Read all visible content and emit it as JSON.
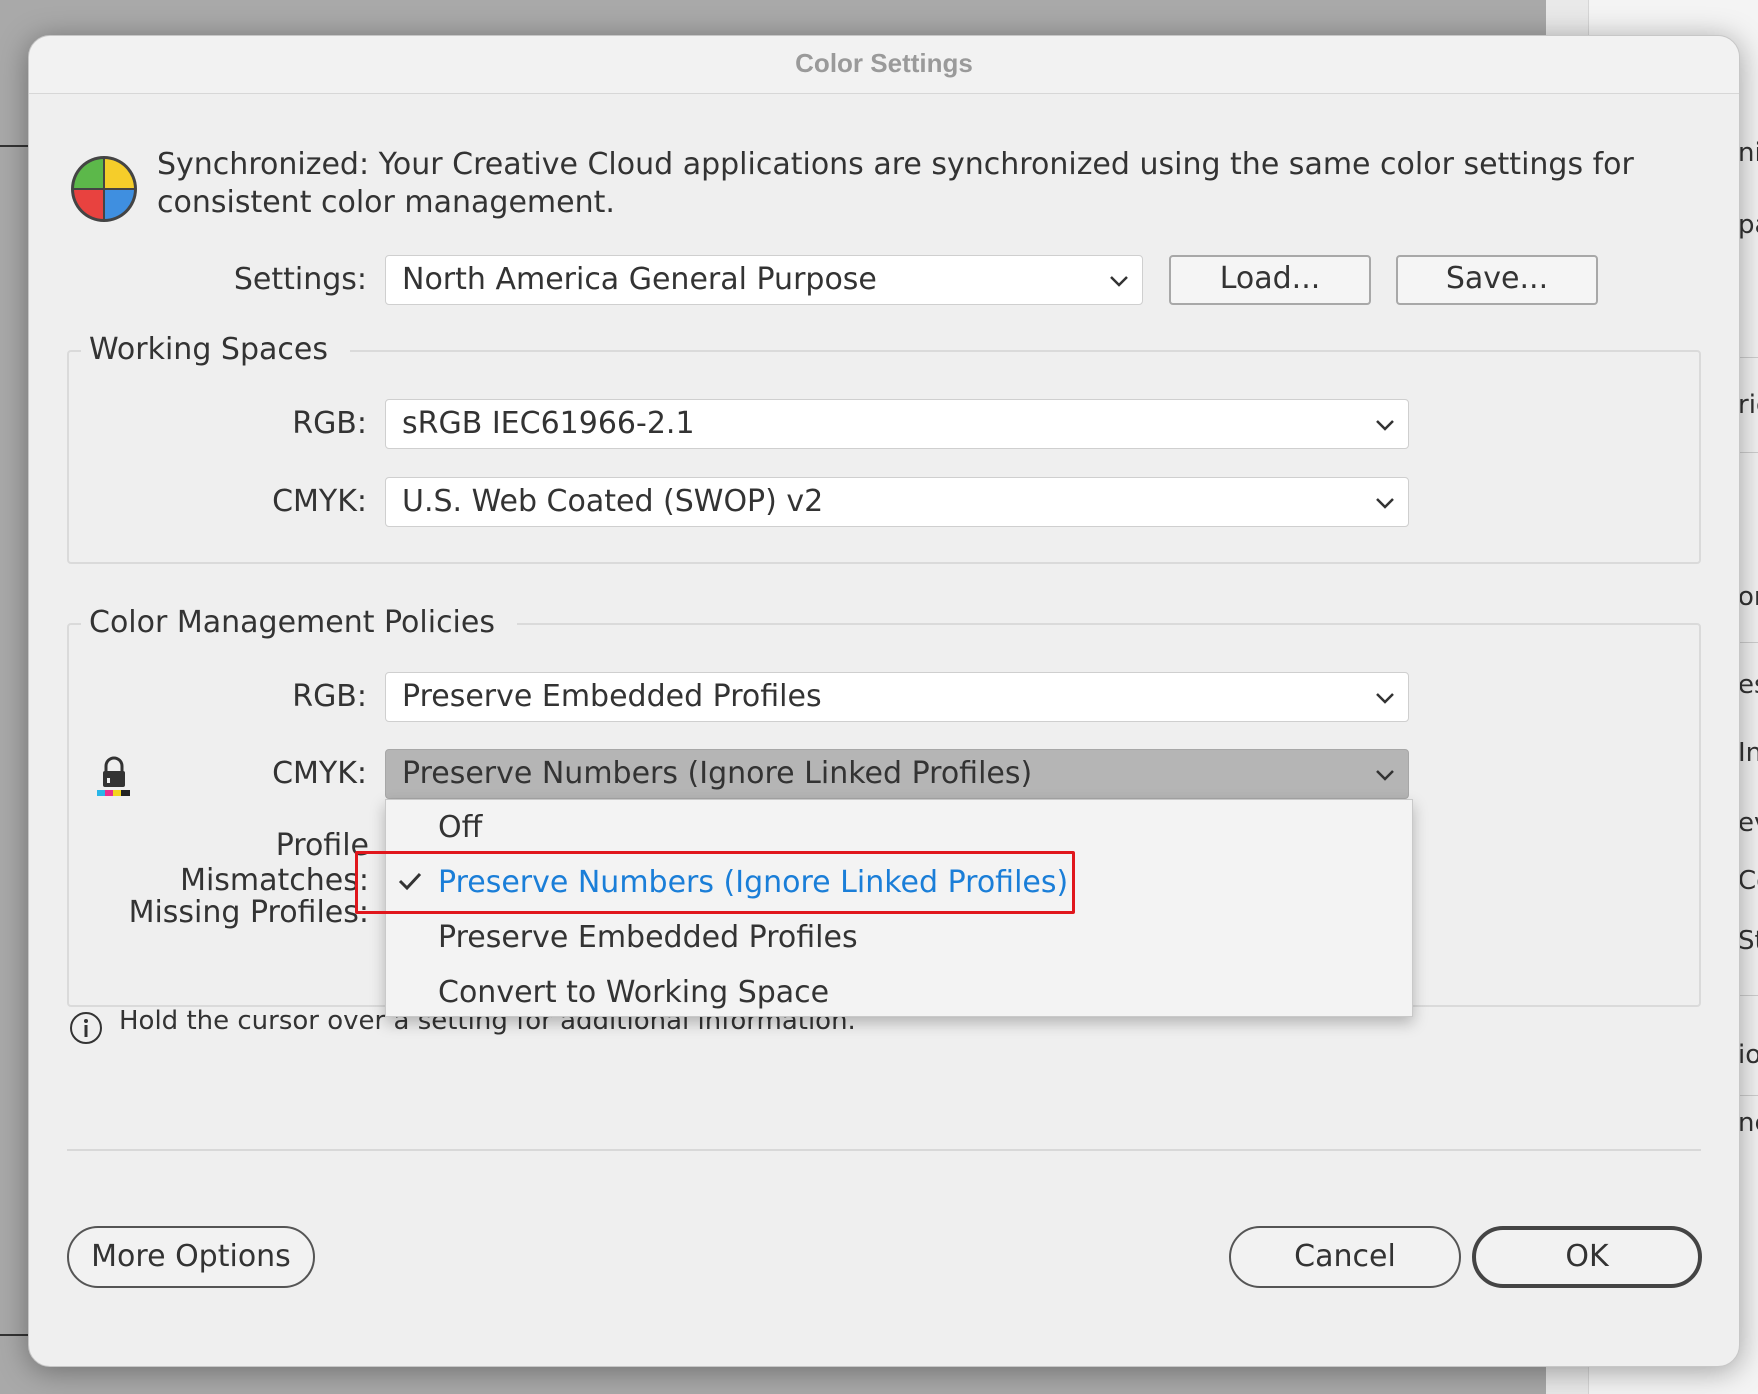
{
  "dialog": {
    "title": "Color Settings",
    "sync_message": "Synchronized: Your Creative Cloud applications are synchronized using the same color settings for consistent color management."
  },
  "settings": {
    "label": "Settings:",
    "value": "North America General Purpose",
    "load_label": "Load...",
    "save_label": "Save..."
  },
  "working_spaces": {
    "title": "Working Spaces",
    "rgb_label": "RGB:",
    "rgb_value": "sRGB IEC61966-2.1",
    "cmyk_label": "CMYK:",
    "cmyk_value": "U.S. Web Coated (SWOP) v2"
  },
  "policies": {
    "title": "Color Management Policies",
    "rgb_label": "RGB:",
    "rgb_value": "Preserve Embedded Profiles",
    "cmyk_label": "CMYK:",
    "cmyk_value": "Preserve Numbers (Ignore Linked Profiles)",
    "profile_mismatches_label": "Profile Mismatches:",
    "missing_profiles_label": "Missing Profiles:",
    "dropdown_options": [
      "Off",
      "Preserve Numbers (Ignore Linked Profiles)",
      "Preserve Embedded Profiles",
      "Convert to Working Space"
    ],
    "selected_option": "Preserve Numbers (Ignore Linked Profiles)"
  },
  "info": {
    "text": "Hold the cursor over a setting for additional information."
  },
  "footer": {
    "more_options_label": "More Options",
    "cancel_label": "Cancel",
    "ok_label": "OK"
  },
  "background_fragments": [
    "ni",
    "pa",
    "ric",
    "or",
    "es",
    "In",
    "ev",
    "Co",
    "Str",
    "io",
    "ne"
  ],
  "colors": {
    "selected_item": "#1a7ed8",
    "highlight_border": "#e0161c",
    "dialog_bg": "#efefef"
  }
}
